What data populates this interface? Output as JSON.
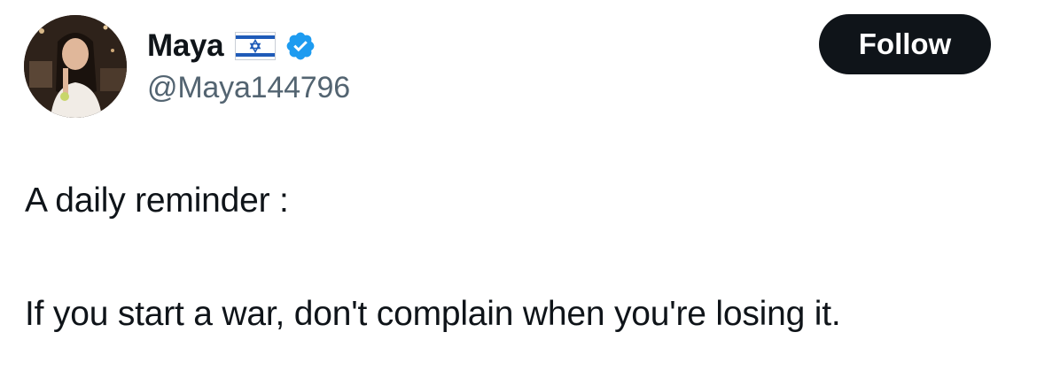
{
  "user": {
    "display_name": "Maya",
    "handle": "@Maya144796",
    "flag_icon": "israel-flag-icon",
    "verified_icon": "verified-badge-icon",
    "verified_color": "#1d9bf0"
  },
  "follow_button": {
    "label": "Follow",
    "background": "#0f1419",
    "text_color": "#ffffff"
  },
  "tweet": {
    "lines": [
      "A daily reminder :",
      "If you start a war, don't complain when you're losing it."
    ]
  }
}
